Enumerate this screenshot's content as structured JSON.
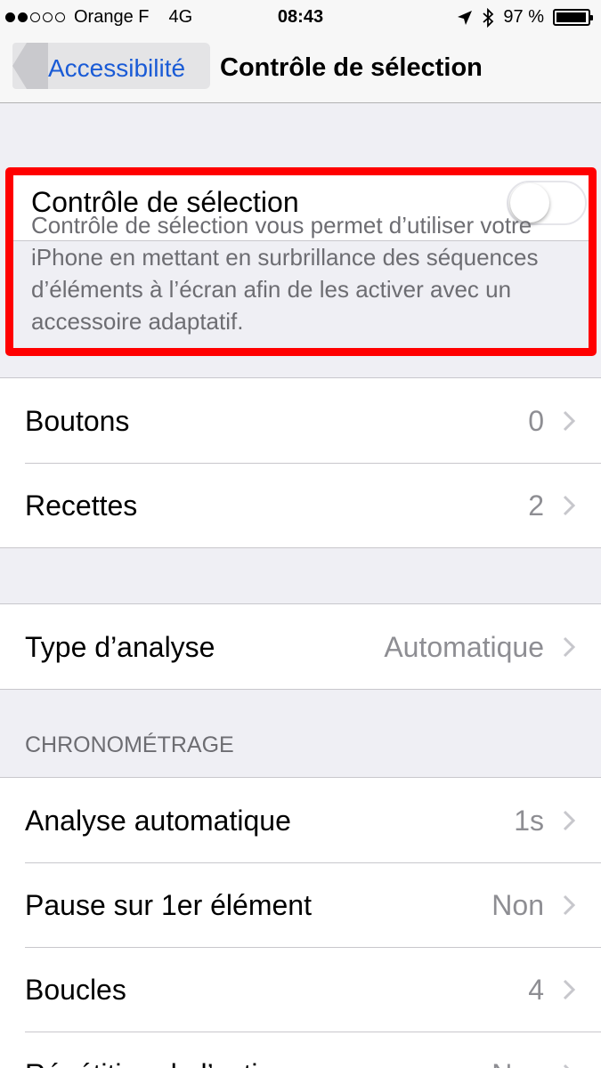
{
  "status_bar": {
    "signal_dots_filled": 2,
    "signal_dots_total": 5,
    "carrier": "Orange F",
    "network": "4G",
    "time": "08:43",
    "location_icon": "location-arrow-icon",
    "bluetooth_icon": "bluetooth-icon",
    "battery_percent_text": "97 %",
    "battery_level": 0.97
  },
  "nav": {
    "back_label": "Accessibilité",
    "title": "Contrôle de sélection"
  },
  "switch_control": {
    "label": "Contrôle de sélection",
    "enabled": false,
    "description": "Contrôle de sélection vous permet d’utiliser votre iPhone en mettant en surbrillance des séquences d’éléments à l’écran afin de les activer avec un accessoire adaptatif.",
    "highlight_color": "#ff0000"
  },
  "group1": [
    {
      "label": "Boutons",
      "value": "0"
    },
    {
      "label": "Recettes",
      "value": "2"
    }
  ],
  "group2": [
    {
      "label": "Type d’analyse",
      "value": "Automatique"
    }
  ],
  "timing_section": {
    "header": "CHRONOMÉTRAGE",
    "rows": [
      {
        "label": "Analyse automatique",
        "value": "1s"
      },
      {
        "label": "Pause sur 1er élément",
        "value": "Non"
      },
      {
        "label": "Boucles",
        "value": "4"
      },
      {
        "label": "Répétition de l’action",
        "value": "Non"
      }
    ]
  },
  "colors": {
    "accent": "#1a5bd6",
    "background": "#efeff4",
    "secondary_text": "#8e8e93"
  }
}
